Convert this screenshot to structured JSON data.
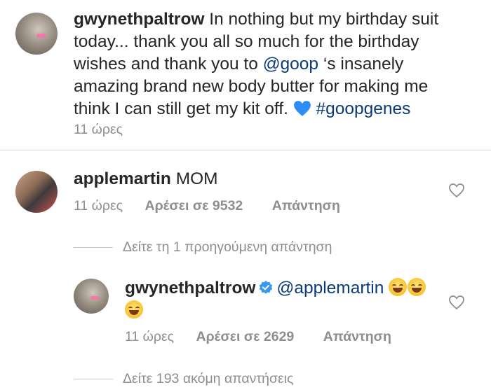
{
  "post": {
    "username": "gwynethpaltrow",
    "caption_line1": "In nothing but my birthday suit",
    "caption_line2": "today... thank you all so much for the birthday",
    "caption_line3": "wishes and thank you to",
    "mention": "@goop",
    "caption_line3b": "‘s insanely",
    "caption_line4": "amazing brand new body butter for making me",
    "caption_line5": "think I can still get my kit off.",
    "heart_icon": "blue-heart-emoji",
    "hashtag": "#goopgenes",
    "time": "11 ώρες"
  },
  "comment1": {
    "username": "applemartin",
    "text": "MOM",
    "time": "11 ώρες",
    "likes": "Αρέσει σε 9532",
    "reply": "Απάντηση",
    "view_previous": "Δείτε τη 1 προηγούμενη απάντηση"
  },
  "reply1": {
    "username": "gwynethpaltrow",
    "verified_icon": "verified-badge-icon",
    "mention": "@applemartin",
    "emoji": "face-with-tears-of-joy-emoji",
    "time": "11 ώρες",
    "likes": "Αρέσει σε 2629",
    "reply": "Απάντηση",
    "view_more": "Δείτε 193 ακόμη απαντήσεις"
  },
  "colors": {
    "text": "#262626",
    "secondary": "#8e8e8e",
    "link": "#0a3a7a",
    "verified": "#3897f0",
    "heart_emoji": "#2f8ef5"
  }
}
